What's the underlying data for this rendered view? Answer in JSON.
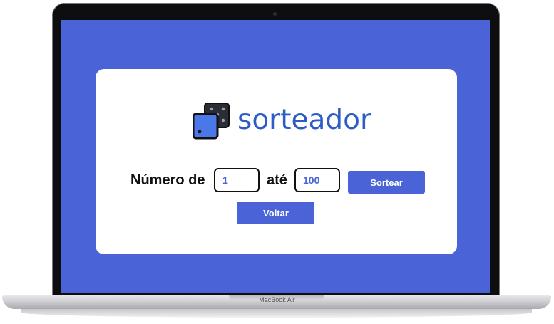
{
  "app": {
    "logo_text": "sorteador",
    "logo_icon": "dice-icon",
    "accent_color": "#4a63d6"
  },
  "form": {
    "from_label": "Número de",
    "from_value": "1",
    "to_label": "até",
    "to_value": "100",
    "draw_button_label": "Sortear",
    "back_button_label": "Voltar"
  },
  "device": {
    "brand_label": "MacBook Air"
  }
}
